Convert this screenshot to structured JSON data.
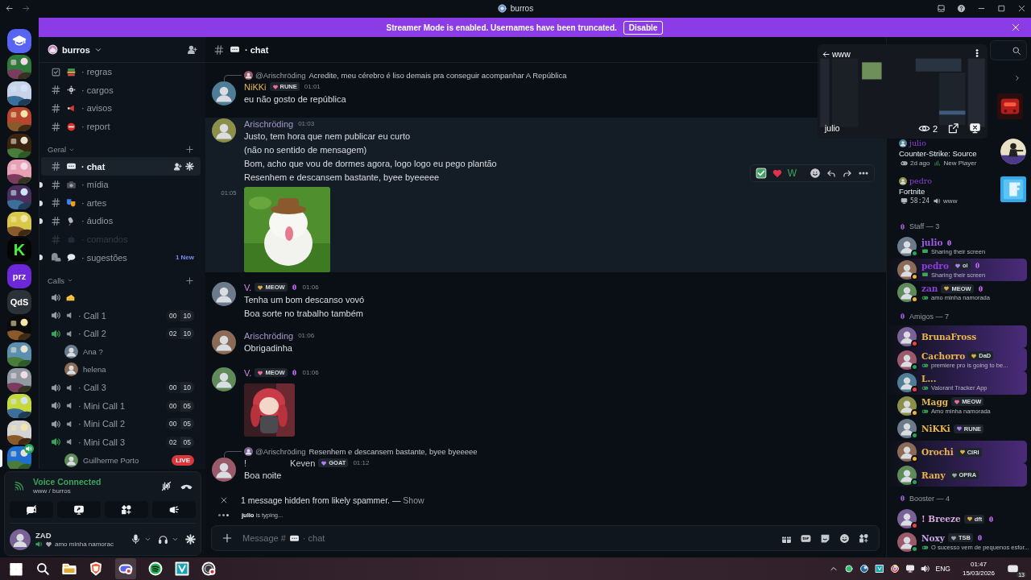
{
  "titlebar": {
    "title": "burros"
  },
  "banner": {
    "text": "Streamer Mode is enabled. Usernames have been truncated.",
    "button": "Disable"
  },
  "servers": [
    {
      "kind": "icon",
      "color": "#5865f2",
      "selected": false,
      "voice": false
    },
    {
      "kind": "picture",
      "color": "#2f7a3a",
      "selected": false,
      "voice": false
    },
    {
      "kind": "picture",
      "color": "#c9d2e8",
      "selected": false,
      "voice": false
    },
    {
      "kind": "picture",
      "color": "#b8462f",
      "selected": false,
      "voice": false
    },
    {
      "kind": "picture",
      "color": "#3a2410",
      "selected": false,
      "voice": false
    },
    {
      "kind": "picture",
      "color": "#e7a0b4",
      "selected": false,
      "voice": false
    },
    {
      "kind": "picture",
      "color": "#4a2f5e",
      "selected": false,
      "voice": false
    },
    {
      "kind": "picture",
      "color": "#d9c94a",
      "selected": false,
      "voice": false
    },
    {
      "kind": "label",
      "label": "K",
      "color": "#050505",
      "selected": false,
      "voice": false
    },
    {
      "kind": "label",
      "label": "prz",
      "color": "#6d28d9",
      "selected": false,
      "voice": false
    },
    {
      "kind": "label",
      "label": "QdS",
      "color": "#2b3138",
      "selected": false,
      "voice": false
    },
    {
      "kind": "picture",
      "color": "#0a0a0a",
      "selected": false,
      "voice": false
    },
    {
      "kind": "picture",
      "color": "#5b8fb0",
      "selected": false,
      "voice": false
    },
    {
      "kind": "picture",
      "color": "#8f9aa3",
      "selected": false,
      "voice": false
    },
    {
      "kind": "picture",
      "color": "#c7d93a",
      "selected": false,
      "voice": false
    },
    {
      "kind": "picture",
      "color": "#d4d4d4",
      "selected": false,
      "voice": false
    },
    {
      "kind": "picture",
      "color": "#1e6fd0",
      "selected": true,
      "voice": true
    }
  ],
  "server": {
    "name": "burros"
  },
  "channel_groups": [
    {
      "channels": [
        {
          "kind": "rules",
          "name": "· regras",
          "selected": false,
          "unread": false,
          "muted": false
        },
        {
          "kind": "text",
          "name": "· cargos",
          "selected": false,
          "unread": false,
          "muted": false
        },
        {
          "kind": "text",
          "name": "· avisos",
          "selected": false,
          "unread": false,
          "muted": false
        },
        {
          "kind": "text",
          "name": "· report",
          "selected": false,
          "unread": false,
          "muted": false
        }
      ]
    },
    {
      "title": "Geral",
      "channels": [
        {
          "kind": "text",
          "name": "· chat",
          "selected": true,
          "unread": false,
          "muted": false
        },
        {
          "kind": "text",
          "name": "· mídia",
          "selected": false,
          "unread": true,
          "muted": false
        },
        {
          "kind": "text",
          "name": "· artes",
          "selected": false,
          "unread": true,
          "muted": false
        },
        {
          "kind": "text",
          "name": "· áudios",
          "selected": false,
          "unread": true,
          "muted": false
        },
        {
          "kind": "text",
          "name": "· comandos",
          "selected": false,
          "unread": false,
          "muted": true
        },
        {
          "kind": "forum",
          "name": "· sugestões",
          "badge": "1 New",
          "selected": false,
          "unread": true,
          "muted": false
        }
      ]
    }
  ],
  "voice_group": {
    "title": "Calls",
    "channels": [
      {
        "active": false
      },
      {
        "name": "· Call 1",
        "active": false,
        "count": "00",
        "limit": "10"
      },
      {
        "name": "· Call 2",
        "active": true,
        "count": "02",
        "limit": "10",
        "users": [
          {
            "name": "Ana ?"
          },
          {
            "name": "helena"
          }
        ]
      },
      {
        "name": "· Call 3",
        "active": false,
        "count": "00",
        "limit": "10"
      },
      {
        "name": "· Mini Call 1",
        "active": false,
        "count": "00",
        "limit": "05"
      },
      {
        "name": "· Mini Call 2",
        "active": false,
        "count": "00",
        "limit": "05"
      },
      {
        "name": "· Mini Call 3",
        "active": true,
        "count": "02",
        "limit": "05",
        "users": [
          {
            "name": "Guilherme Porto",
            "live": "LIVE"
          }
        ]
      }
    ]
  },
  "voice_panel": {
    "status": "Voice Connected",
    "location": "www / burros"
  },
  "user_panel": {
    "name": "ZAD",
    "status": "amo minha namorac"
  },
  "chat": {
    "channel": "· chat",
    "messages": [
      {
        "kind": "message",
        "reply": {
          "author": "@Arischröding",
          "text": "Acredite, meu cérebro é liso demais pra conseguir acompanhar A República"
        },
        "author": "NiKKi",
        "color": "#e6b54a",
        "tag": "RUNE",
        "time": "01:01",
        "lines": [
          "eu não gosto de república"
        ],
        "hovered": false
      },
      {
        "kind": "message",
        "author": "Arischröding",
        "color": "#a897c8",
        "time": "01:03",
        "lines": [
          "Justo, tem hora que nem publicar eu curto",
          "(não no sentido de mensagem)",
          "Bom, acho que vou de dormes agora, logo logo eu pego plantão",
          "Resenhem e descansem bastante, byee byeeeee"
        ],
        "attachment_time": "01:05",
        "attachment": {
          "kind": "picture"
        },
        "hovered": true,
        "reaction_text": "W"
      },
      {
        "kind": "message",
        "author": "V.",
        "color": "#d38be6",
        "tag": "MEOW",
        "time": "01:06",
        "lines": [
          "Tenha um bom descanso vovó",
          "Boa sorte no trabalho também"
        ],
        "hovered": false
      },
      {
        "kind": "message",
        "author": "Arischröding",
        "color": "#a897c8",
        "time": "01:06",
        "lines": [
          "Obrigadinha"
        ],
        "hovered": false
      },
      {
        "kind": "message",
        "author": "V.",
        "color": "#d38be6",
        "tag": "MEOW",
        "time": "01:06",
        "attachment": {
          "kind": "picture"
        },
        "hovered": false
      },
      {
        "kind": "message",
        "reply": {
          "author": "@Arischröding",
          "text": "Resenhem e descansem bastante, byee byeeeee"
        },
        "prefix": "!",
        "author": "Keven",
        "color": "#c9ccd1",
        "tag": "GOAT",
        "time": "01:12",
        "lines": [
          "Boa noite"
        ],
        "hovered": false
      },
      {
        "kind": "system",
        "text": "1 message hidden from likely spammer. — ",
        "link": "Show"
      }
    ],
    "typing": "**julio** is typing...",
    "composer": {
      "prompt": "Message #",
      "channel": "· chat"
    }
  },
  "members": {
    "activities": [
      {
        "kind": "game",
        "user": "julio",
        "title": "Counter-Strike: Source",
        "detail": "2d ago",
        "extra": "New Player"
      },
      {
        "kind": "stream",
        "user": "pedro",
        "title": "Fortnite",
        "detail": "58:24",
        "extra": "www"
      }
    ],
    "groups": [
      {
        "title": "Staff — 3",
        "members": [
          {
            "name": "julio",
            "color": "#a259e6",
            "status_text": "Sharing their screen",
            "status": {
              "color": "#23a55a"
            },
            "highlight": false
          },
          {
            "name": "pedro",
            "color": "#8c3fd6",
            "tag": "oi",
            "status_text": "Sharing their screen",
            "status": {
              "color": "#f0b232"
            },
            "highlight": true
          },
          {
            "name": "zan",
            "color": "#8c3fd6",
            "tag": "MEOW",
            "status_text": "amo minha namorada",
            "status": {
              "color": "#f0b232"
            },
            "highlight": false
          }
        ]
      },
      {
        "title": "Amigos — 7",
        "members": [
          {
            "name": "BrunaFross",
            "color": "#e8b64c",
            "status": {
              "color": "#f23f43"
            },
            "highlight": true
          },
          {
            "name": "Cachorro",
            "color": "#e8b64c",
            "tag": "DaD",
            "status_text": "premiere pro is going to be...",
            "status": {
              "color": "#23a55a"
            },
            "highlight": true
          },
          {
            "name": "L...",
            "color": "#e8b64c",
            "status_text": "Valorant Tracker App",
            "status": {
              "color": "#f23f43"
            },
            "highlight": true
          },
          {
            "name": "Magg",
            "color": "#e8b64c",
            "tag": "MEOW",
            "status_text": "Amo minha namorada",
            "status": {
              "color": "#f0b232"
            },
            "highlight": false
          },
          {
            "name": "NiKKi",
            "color": "#e8b64c",
            "tag": "RUNE",
            "status": {
              "color": "#23a55a"
            },
            "highlight": false
          },
          {
            "name": "Orochi",
            "color": "#e8b64c",
            "tag": "CIRI",
            "status": {
              "color": "#f0b232"
            },
            "highlight": true
          },
          {
            "name": "Rany",
            "color": "#e8b64c",
            "tag": "OPRA",
            "status": {
              "color": "#23a55a"
            },
            "highlight": true
          }
        ]
      },
      {
        "title": "Booster — 4",
        "members": [
          {
            "name": "! Breeze",
            "color": "#d7a8dc",
            "tag": "dft",
            "status": {
              "color": "#f23f43"
            },
            "highlight": false
          },
          {
            "name": "Noxy",
            "color": "#c9a2ea",
            "tag": "TSB",
            "status_text": "O sucesso vem de pequenos esfor...",
            "status": {
              "color": "#23a55a"
            },
            "highlight": false
          }
        ]
      }
    ]
  },
  "stream_overlay": {
    "title": "www",
    "user": "julio",
    "viewers": "2"
  },
  "taskbar": {
    "language": "ENG",
    "time": "01:47",
    "date": "15/03/2026",
    "notifications": "13"
  }
}
